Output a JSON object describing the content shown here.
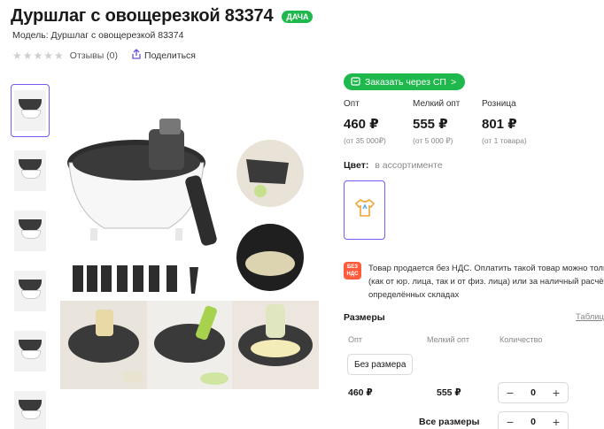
{
  "product": {
    "title": "Дуршлаг с овощерезкой 83374",
    "badge": "ДАЧА",
    "model": "Модель: Дуршлаг с овощерезкой 83374",
    "reviews": "Отзывы (0)",
    "share": "Поделиться"
  },
  "order_sp": {
    "label": "Заказать через СП",
    "arrow": ">"
  },
  "prices": [
    {
      "label": "Опт",
      "value": "460 ₽",
      "note": "(от 35 000₽)"
    },
    {
      "label": "Мелкий опт",
      "value": "555 ₽",
      "note": "(от 5 000 ₽)"
    },
    {
      "label": "Розница",
      "value": "801 ₽",
      "note": "(от 1 товара)"
    }
  ],
  "color": {
    "label": "Цвет:",
    "value": "в ассортименте"
  },
  "vat": {
    "icon": "БЕЗ НДС",
    "line1": "Товар продается без НДС. Оплатить такой товар можно толь",
    "line2": "(как от юр. лица, так и от физ. лица) или за наличный расчёт",
    "line3": "определённых складах"
  },
  "sizes": {
    "title": "Размеры",
    "table_link": "Таблиц",
    "columns": {
      "opt": "Опт",
      "small_opt": "Мелкий опт",
      "quantity": "Количество"
    },
    "size_button": "Без размера",
    "row": {
      "opt": "460 ₽",
      "small_opt": "555 ₽",
      "qty": "0"
    },
    "all_sizes": {
      "label": "Все размеры",
      "qty": "0"
    }
  },
  "stepper": {
    "minus": "−",
    "plus": "+"
  },
  "icons": {
    "stars": "★★★★★",
    "share": "share-icon",
    "cart": "cart-icon",
    "tshirt": "tshirt-icon"
  },
  "colors": {
    "accent": "#7a5af0",
    "green": "#1eb84c",
    "vat": "#ff5b3d"
  }
}
